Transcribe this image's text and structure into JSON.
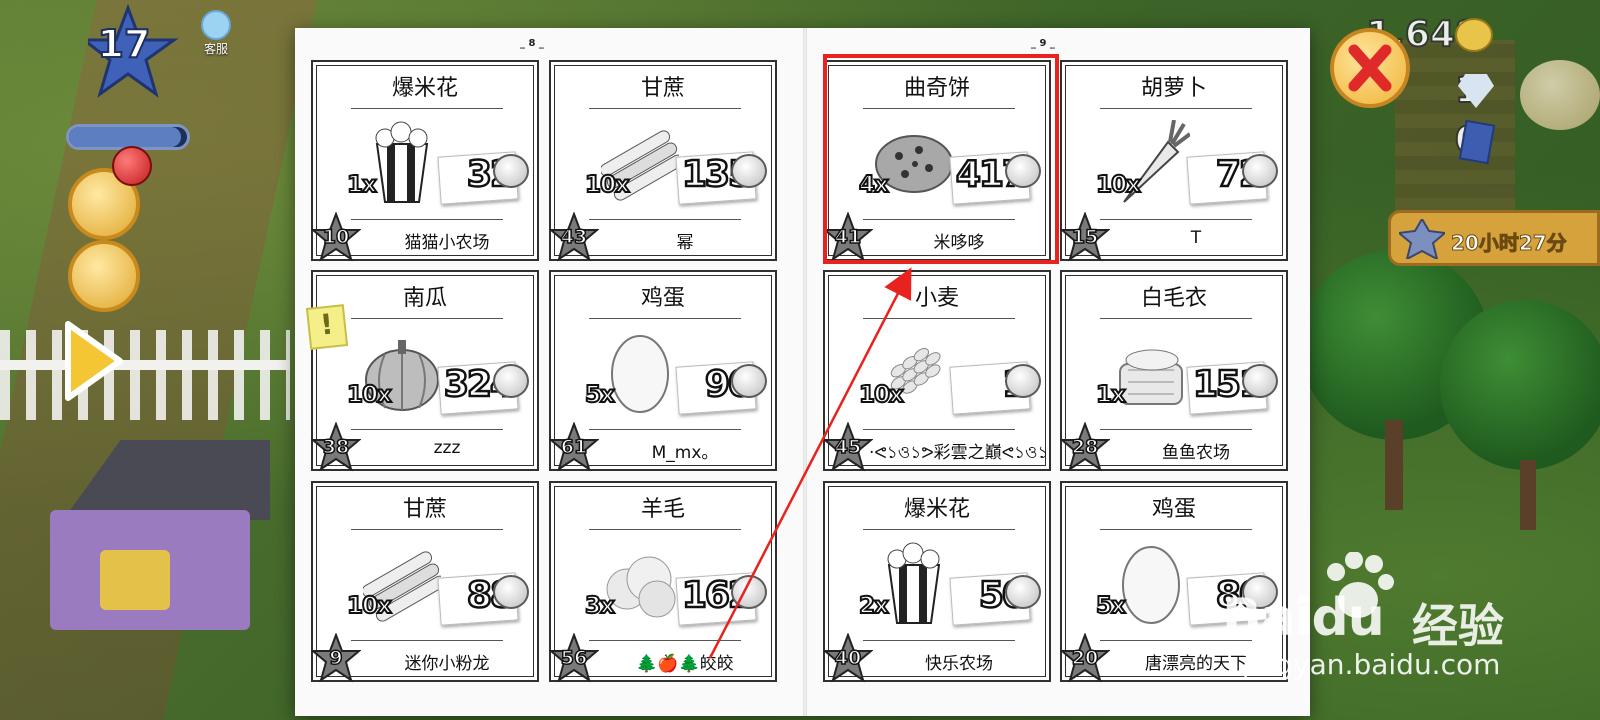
{
  "hud": {
    "level": "17",
    "service_label": "客服",
    "xp_progress": 0.95,
    "coins": "1,648",
    "diamonds": "1",
    "vouchers": "0",
    "timer_label": "20小时27分"
  },
  "newspaper": {
    "left_page": "8",
    "right_page": "9",
    "highlighted_index": 2,
    "listings": [
      {
        "item": "爆米花",
        "icon": "popcorn-icon",
        "qty": "1x",
        "price": "32",
        "level": "10",
        "seller": "猫猫小农场"
      },
      {
        "item": "甘蔗",
        "icon": "sugarcane-icon",
        "qty": "10x",
        "price": "135",
        "level": "43",
        "seller": "幂"
      },
      {
        "item": "曲奇饼",
        "icon": "cookie-icon",
        "qty": "4x",
        "price": "417",
        "level": "41",
        "seller": "米哆哆"
      },
      {
        "item": "胡萝卜",
        "icon": "carrot-icon",
        "qty": "10x",
        "price": "72",
        "level": "15",
        "seller": "T"
      },
      {
        "item": "南瓜",
        "icon": "pumpkin-icon",
        "qty": "10x",
        "price": "324",
        "level": "38",
        "seller": "zzz"
      },
      {
        "item": "鸡蛋",
        "icon": "egg-icon",
        "qty": "5x",
        "price": "90",
        "level": "61",
        "seller": "M_mx。"
      },
      {
        "item": "小麦",
        "icon": "wheat-icon",
        "qty": "10x",
        "price": "1",
        "level": "45",
        "seller": "·ᕙ১ও১ᕗ彩雲之巔ᕙ১ও১ᕗ·"
      },
      {
        "item": "白毛衣",
        "icon": "sweater-icon",
        "qty": "1x",
        "price": "151",
        "level": "28",
        "seller": "鱼鱼农场"
      },
      {
        "item": "甘蔗",
        "icon": "sugarcane-icon",
        "qty": "10x",
        "price": "88",
        "level": "9",
        "seller": "迷你小粉龙"
      },
      {
        "item": "羊毛",
        "icon": "wool-icon",
        "qty": "3x",
        "price": "162",
        "level": "56",
        "seller": "🌲🍎🌲皎皎"
      },
      {
        "item": "爆米花",
        "icon": "popcorn-icon",
        "qty": "2x",
        "price": "50",
        "level": "40",
        "seller": "快乐农场"
      },
      {
        "item": "鸡蛋",
        "icon": "egg-icon",
        "qty": "5x",
        "price": "80",
        "level": "20",
        "seller": "唐漂亮的天下"
      }
    ]
  },
  "watermark": {
    "brand": "Baidu",
    "suffix": "经验",
    "url": "jingyan.baidu.com"
  },
  "colors": {
    "highlight": "#e8231f",
    "paper": "#fafafa"
  }
}
